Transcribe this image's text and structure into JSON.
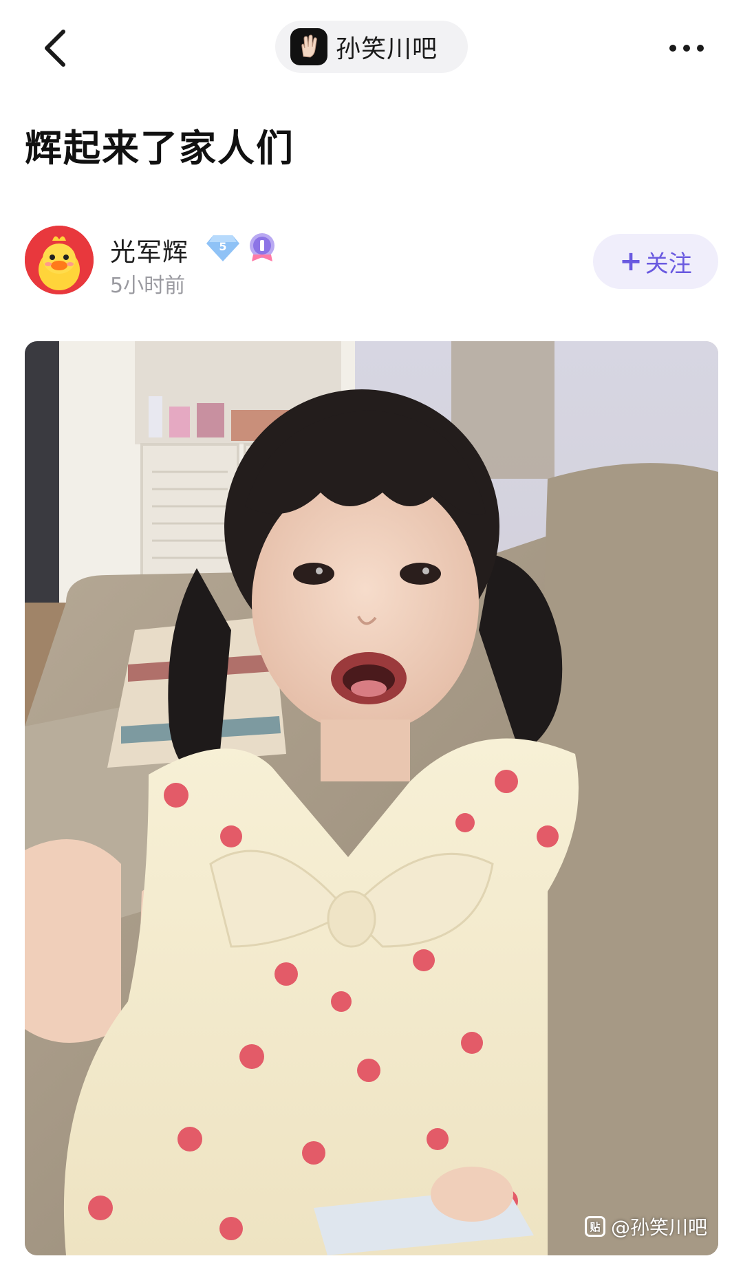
{
  "nav": {
    "forum_name": "孙笑川吧",
    "icons": {
      "back": "chevron-left-icon",
      "more": "more-horizontal-icon",
      "forum_logo": "hand-gesture-logo"
    }
  },
  "post": {
    "title": "辉起来了家人们"
  },
  "author": {
    "name": "光军辉",
    "level": "5",
    "time": "5小时前",
    "follow_label": "关注",
    "follow_prefix": "+"
  },
  "image": {
    "description_icon": "photo-of-girl-on-sofa",
    "watermark": "@孙笑川吧",
    "watermark_icon": "贴"
  },
  "colors": {
    "accent": "#6a5ae0",
    "follow_bg": "#f0eefb",
    "muted": "#9a9aa0"
  }
}
